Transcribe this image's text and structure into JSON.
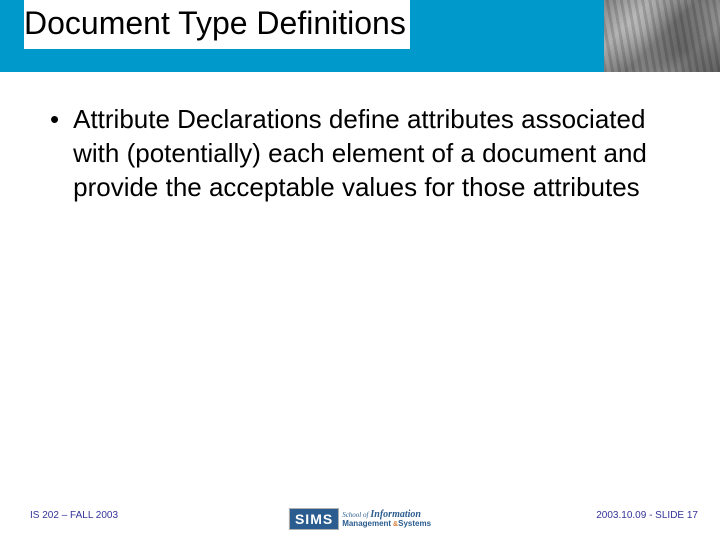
{
  "header": {
    "title": "Document Type Definitions"
  },
  "content": {
    "bullet_text": "Attribute Declarations define attributes associated with (potentially) each element of a document and provide the acceptable values for those attributes"
  },
  "footer": {
    "left": "IS 202 – FALL 2003",
    "right": "2003.10.09 - SLIDE 17",
    "logo": {
      "sims": "SIMS",
      "school_of": "School of",
      "information": "Information",
      "management": "Management",
      "amp": "&",
      "systems": "Systems"
    }
  }
}
